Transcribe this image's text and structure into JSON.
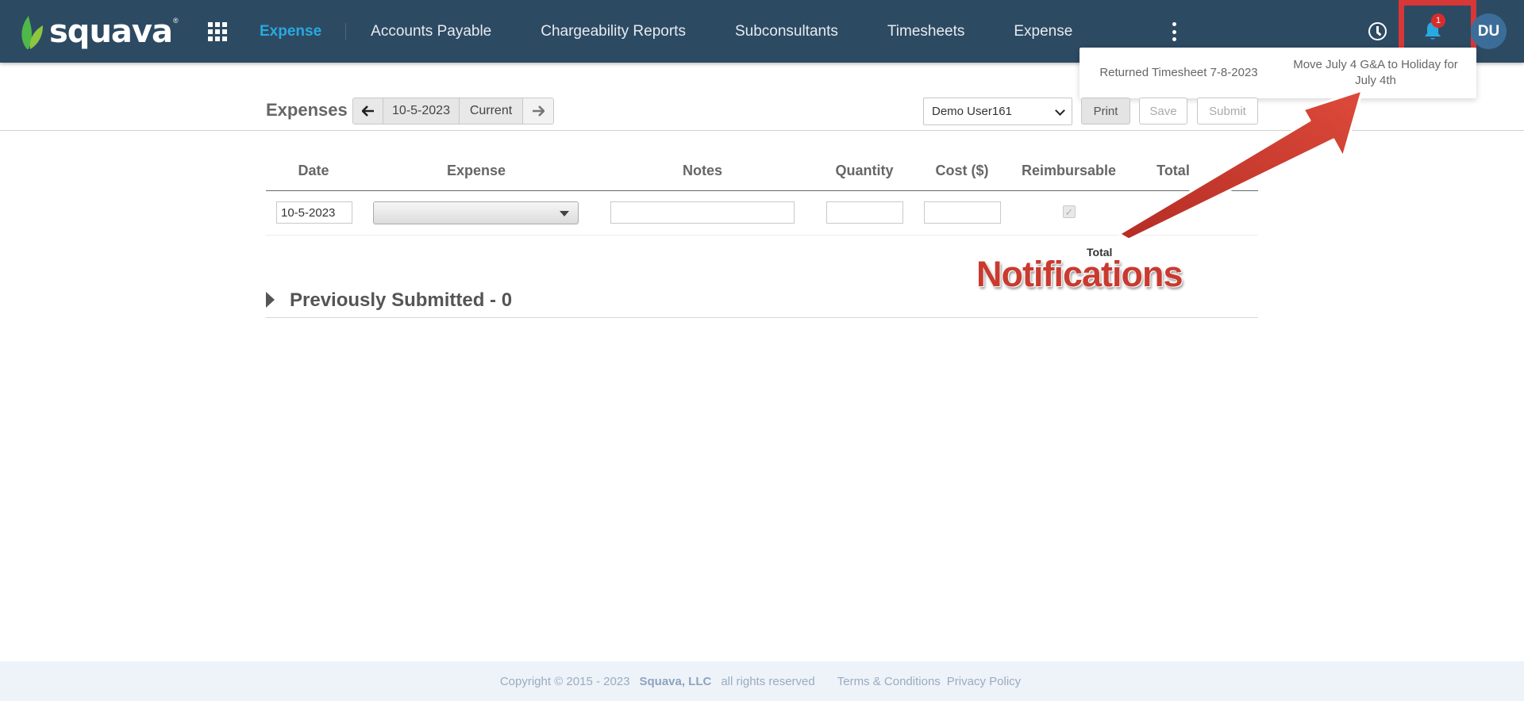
{
  "app": {
    "logo_text": "squava",
    "logo_mark": "®",
    "icons": {
      "apps": "apps-grid-icon",
      "more": "kebab-icon",
      "timer": "clock-icon",
      "notifications": "bell-icon"
    },
    "accent_color": "#29a9e0",
    "nav_color": "#2d4a63"
  },
  "nav": {
    "items": [
      "Expense",
      "Accounts Payable",
      "Chargeability Reports",
      "Subconsultants",
      "Timesheets",
      "Expense"
    ],
    "notification_count": "1",
    "avatar_initials": "DU"
  },
  "notifications": {
    "items": [
      "Returned Timesheet 7-8-2023",
      "Move July 4 G&A to Holiday for July 4th"
    ]
  },
  "toolbar": {
    "title": "Expenses",
    "date": "10-5-2023",
    "current_label": "Current",
    "user": "Demo User161",
    "print_label": "Print",
    "save_label": "Save",
    "submit_label": "Submit"
  },
  "table": {
    "headers": [
      "Date",
      "Expense",
      "Notes",
      "Quantity",
      "Cost ($)",
      "Reimbursable",
      "Total"
    ],
    "row": {
      "date": "10-5-2023",
      "expense": "",
      "notes": "",
      "quantity": "",
      "cost": "",
      "reimbursable": "✓"
    },
    "total_label": "Total"
  },
  "previous": {
    "title": "Previously Submitted - 0"
  },
  "annotation": {
    "label": "Notifications",
    "color": "#c93a2f"
  },
  "footer": {
    "copyright": "Copyright © 2015 - 2023",
    "company": "Squava, LLC",
    "rights": "all rights reserved",
    "terms": "Terms & Conditions",
    "privacy": "Privacy Policy"
  }
}
